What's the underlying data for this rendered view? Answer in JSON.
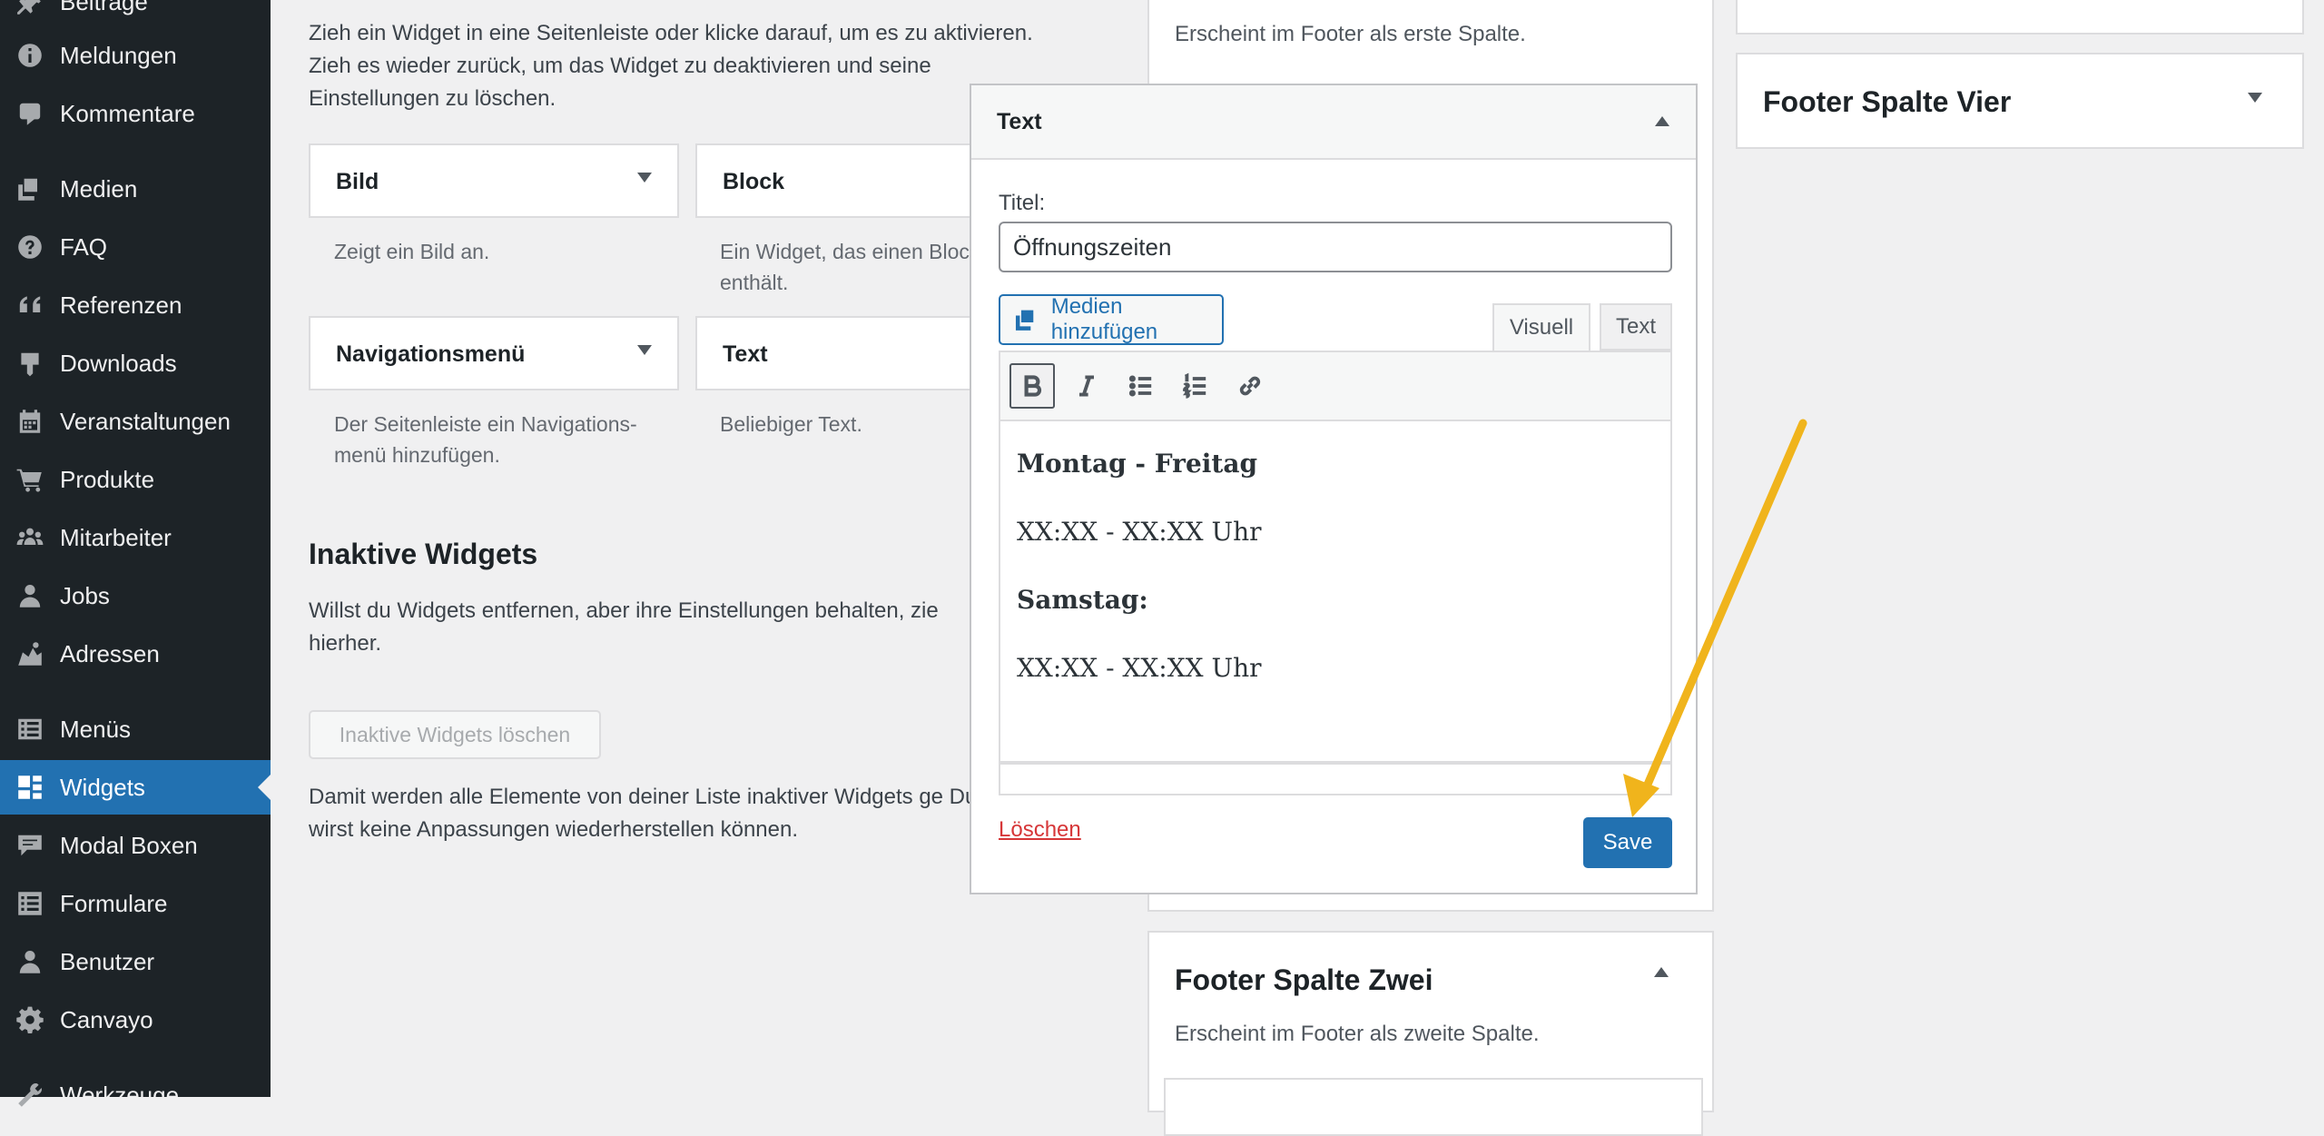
{
  "sidebar": {
    "items": [
      {
        "label": "Beiträge",
        "icon": "pin-icon"
      },
      {
        "label": "Meldungen",
        "icon": "info-icon"
      },
      {
        "label": "Kommentare",
        "icon": "comment-icon"
      },
      {
        "label": "Medien",
        "icon": "media-icon"
      },
      {
        "label": "FAQ",
        "icon": "help-icon"
      },
      {
        "label": "Referenzen",
        "icon": "quote-icon"
      },
      {
        "label": "Downloads",
        "icon": "download-icon"
      },
      {
        "label": "Veranstaltungen",
        "icon": "calendar-icon"
      },
      {
        "label": "Produkte",
        "icon": "cart-icon"
      },
      {
        "label": "Mitarbeiter",
        "icon": "groups-icon"
      },
      {
        "label": "Jobs",
        "icon": "person-icon"
      },
      {
        "label": "Adressen",
        "icon": "location-icon"
      },
      {
        "label": "Menüs",
        "icon": "menu-icon"
      },
      {
        "label": "Widgets",
        "icon": "widgets-icon"
      },
      {
        "label": "Modal Boxen",
        "icon": "modal-icon"
      },
      {
        "label": "Formulare",
        "icon": "forms-icon"
      },
      {
        "label": "Benutzer",
        "icon": "users-icon"
      },
      {
        "label": "Canvayo",
        "icon": "gear-icon"
      },
      {
        "label": "Werkzeuge",
        "icon": "tools-icon"
      }
    ],
    "active": "Widgets",
    "colors": {
      "background": "#1d2327",
      "active": "#2271b1"
    }
  },
  "available": {
    "intro": "Zieh ein Widget in eine Seitenleiste oder klicke darauf, um es zu aktivieren. Zieh es wieder zurück, um das Widget zu deaktivieren und seine Einstellungen zu löschen.",
    "widgets": [
      {
        "title": "Bild",
        "desc": "Zeigt ein Bild an."
      },
      {
        "title": "Block",
        "desc": "Ein Widget, das einen Bloc enthält."
      },
      {
        "title": "Navigationsmenü",
        "desc": "Der Seitenleiste ein Navigations- menü hinzufügen."
      },
      {
        "title": "Text",
        "desc": "Beliebiger Text."
      }
    ]
  },
  "inactive": {
    "title": "Inaktive Widgets",
    "desc": "Willst du Widgets entfernen, aber ihre Einstellungen behalten, zie hierher.",
    "button": "Inaktive Widgets löschen",
    "note": "Damit werden alle Elemente von deiner Liste inaktiver Widgets ge Du wirst keine Anpassungen wiederherstellen können."
  },
  "sidebars": {
    "spalte_eins_desc": "Erscheint im Footer als erste Spalte.",
    "spalte_zwei_title": "Footer Spalte Zwei",
    "spalte_zwei_desc": "Erscheint im Footer als zweite Spalte.",
    "spalte_vier_title": "Footer Spalte Vier"
  },
  "editor": {
    "header": "Text",
    "title_label": "Titel:",
    "title_value": "Öffnungszeiten",
    "media_button": "Medien hinzufügen",
    "tab_visual": "Visuell",
    "tab_text": "Text",
    "content": [
      "Montag - Freitag",
      "XX:XX - XX:XX Uhr",
      "Samstag:",
      "XX:XX - XX:XX Uhr"
    ],
    "delete_link": "Löschen",
    "save_button": "Save"
  },
  "annotation": {
    "color": "#f0b41c"
  }
}
